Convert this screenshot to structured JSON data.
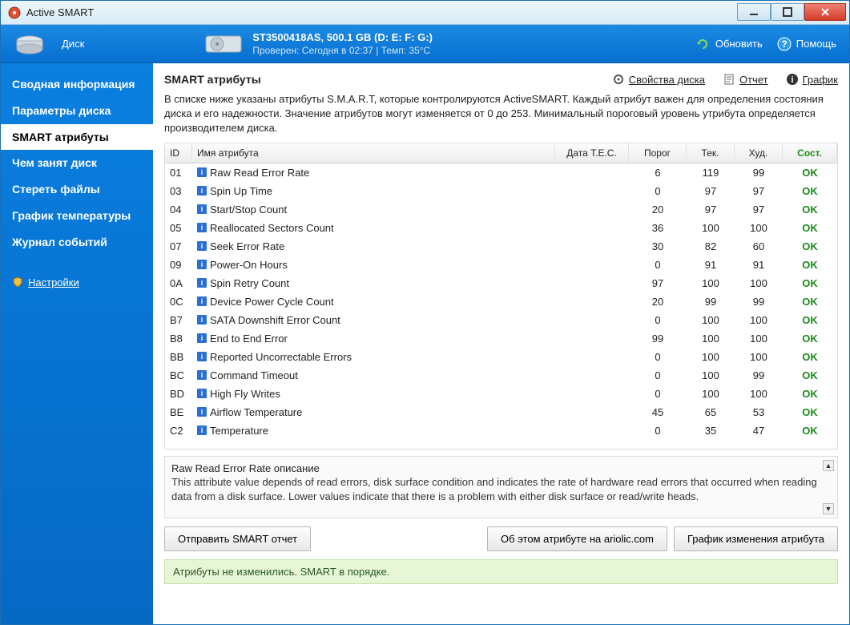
{
  "window": {
    "title": "Active SMART"
  },
  "topbar": {
    "disk_label": "Диск",
    "model": "ST3500418AS, 500.1 GB (D: E: F: G:)",
    "status": "Проверен: Сегодня в 02:37 | Темп: 35°C",
    "refresh": "Обновить",
    "help": "Помощь"
  },
  "sidebar": {
    "items": [
      "Сводная информация",
      "Параметры диска",
      "SMART атрибуты",
      "Чем занят диск",
      "Стереть файлы",
      "График температуры",
      "Журнал событий"
    ],
    "settings": "Настройки",
    "active_index": 2
  },
  "main": {
    "title": "SMART атрибуты",
    "actions": {
      "properties": "Свойства диска",
      "report": "Отчет",
      "chart": "График"
    },
    "description": "В списке ниже указаны атрибуты S.M.A.R.T, которые контролируются ActiveSMART. Каждый атрибут важен для определения состояния диска и его надежности. Значение атрибутов могут изменяется от 0 до 253. Минимальный пороговый уровень утрибута определяется производителем диска.",
    "columns": {
      "id": "ID",
      "name": "Имя атрибута",
      "tec": "Дата T.E.C.",
      "threshold": "Порог",
      "current": "Тек.",
      "worst": "Худ.",
      "status": "Сост."
    },
    "rows": [
      {
        "id": "01",
        "name": "Raw Read Error Rate",
        "tec": "",
        "thr": "6",
        "cur": "119",
        "wor": "99",
        "st": "OK"
      },
      {
        "id": "03",
        "name": "Spin Up Time",
        "tec": "",
        "thr": "0",
        "cur": "97",
        "wor": "97",
        "st": "OK"
      },
      {
        "id": "04",
        "name": "Start/Stop Count",
        "tec": "",
        "thr": "20",
        "cur": "97",
        "wor": "97",
        "st": "OK"
      },
      {
        "id": "05",
        "name": "Reallocated Sectors Count",
        "tec": "",
        "thr": "36",
        "cur": "100",
        "wor": "100",
        "st": "OK"
      },
      {
        "id": "07",
        "name": "Seek Error Rate",
        "tec": "",
        "thr": "30",
        "cur": "82",
        "wor": "60",
        "st": "OK"
      },
      {
        "id": "09",
        "name": "Power-On Hours",
        "tec": "",
        "thr": "0",
        "cur": "91",
        "wor": "91",
        "st": "OK"
      },
      {
        "id": "0A",
        "name": "Spin Retry Count",
        "tec": "",
        "thr": "97",
        "cur": "100",
        "wor": "100",
        "st": "OK"
      },
      {
        "id": "0C",
        "name": "Device Power Cycle Count",
        "tec": "",
        "thr": "20",
        "cur": "99",
        "wor": "99",
        "st": "OK"
      },
      {
        "id": "B7",
        "name": "SATA Downshift Error Count",
        "tec": "",
        "thr": "0",
        "cur": "100",
        "wor": "100",
        "st": "OK"
      },
      {
        "id": "B8",
        "name": "End to End Error",
        "tec": "",
        "thr": "99",
        "cur": "100",
        "wor": "100",
        "st": "OK"
      },
      {
        "id": "BB",
        "name": "Reported Uncorrectable Errors",
        "tec": "",
        "thr": "0",
        "cur": "100",
        "wor": "100",
        "st": "OK"
      },
      {
        "id": "BC",
        "name": "Command Timeout",
        "tec": "",
        "thr": "0",
        "cur": "100",
        "wor": "99",
        "st": "OK"
      },
      {
        "id": "BD",
        "name": "High Fly Writes",
        "tec": "",
        "thr": "0",
        "cur": "100",
        "wor": "100",
        "st": "OK"
      },
      {
        "id": "BE",
        "name": "Airflow Temperature",
        "tec": "",
        "thr": "45",
        "cur": "65",
        "wor": "53",
        "st": "OK"
      },
      {
        "id": "C2",
        "name": "Temperature",
        "tec": "",
        "thr": "0",
        "cur": "35",
        "wor": "47",
        "st": "OK"
      }
    ],
    "detail": {
      "title": "Raw Read Error Rate описание",
      "body": "This attribute value depends of read errors, disk surface condition and indicates the rate of hardware read errors that occurred when reading data from a disk surface. Lower values indicate that there is a problem with either disk surface or read/write heads."
    },
    "buttons": {
      "send": "Отправить SMART отчет",
      "about": "Об этом атрибуте на ariolic.com",
      "chart": "График изменения атрибута"
    },
    "status": "Атрибуты не изменились. SMART в порядке."
  }
}
